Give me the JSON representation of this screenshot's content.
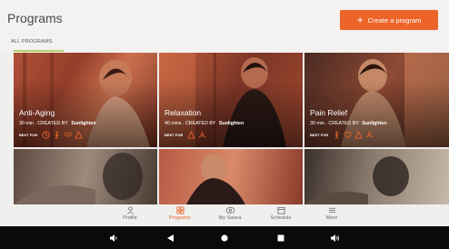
{
  "header": {
    "title": "Programs",
    "create_button_label": "Create a program",
    "filter_tab": "ALL PROGRAMS"
  },
  "programs": [
    {
      "title": "Anti-Aging",
      "duration": "30 min",
      "created_by_prefix": ". CREATED BY",
      "creator": "Sunlighten",
      "best_for_label": "BEST FOR",
      "best_for_icons": [
        "clock-icon",
        "body-icon",
        "skin-icon",
        "flame-icon"
      ]
    },
    {
      "title": "Relaxation",
      "duration": "40 mins",
      "created_by_prefix": ". CREATED BY",
      "creator": "Sunlighten",
      "best_for_label": "BEST FOR",
      "best_for_icons": [
        "flame-icon",
        "relax-icon"
      ]
    },
    {
      "title": "Pain Relief",
      "duration": "30 min",
      "created_by_prefix": ". CREATED BY",
      "creator": "Sunlighten",
      "best_for_label": "BEST FOR",
      "best_for_icons": [
        "body-icon",
        "heart-icon",
        "flame-icon",
        "relax-icon"
      ]
    },
    {
      "title": "",
      "duration": "",
      "creator": ""
    },
    {
      "title": "",
      "duration": "",
      "creator": ""
    },
    {
      "title": "",
      "duration": "",
      "creator": ""
    }
  ],
  "bottom_nav": {
    "active": "Programs",
    "items": [
      "Profile",
      "Programs",
      "My Sauna",
      "Schedule",
      "More"
    ]
  },
  "colors": {
    "accent": "#ec6428",
    "tab_underline": "#b8d06a",
    "background": "#efefed",
    "system_bar": "#0a0a0a"
  },
  "system_bar_icons": [
    "volume-down-icon",
    "back-icon",
    "home-icon",
    "recents-icon",
    "volume-up-icon"
  ]
}
